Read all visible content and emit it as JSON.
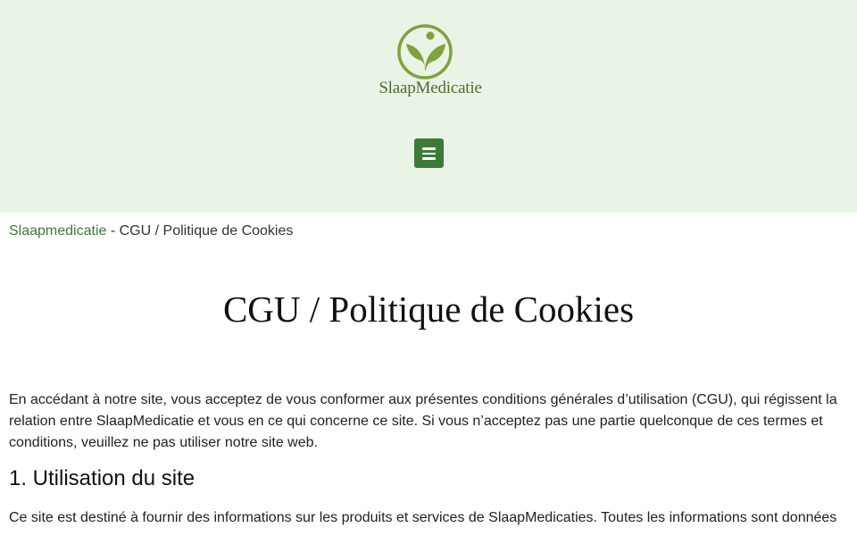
{
  "header": {
    "logo_text": "SlaapMedicatie",
    "logo_icon": "leaf-person-icon",
    "menu_icon": "hamburger-menu-icon",
    "background": "#e9f3e6",
    "accent": "#3d7a38"
  },
  "breadcrumb": {
    "home": "Slaapmedicatie",
    "separator": " - ",
    "current": "CGU / Politique de Cookies"
  },
  "page": {
    "title": "CGU / Politique de Cookies",
    "intro": "En accédant à notre site, vous acceptez de vous conformer aux présentes conditions générales d’utilisation (CGU), qui régissent la relation entre SlaapMedicatie et vous en ce qui concerne ce site. Si vous n’acceptez pas une partie quelconque de ces termes et conditions, veuillez ne pas utiliser notre site web.",
    "section1_heading": "1. Utilisation du site",
    "section1_body": "Ce site est destiné à fournir des informations sur les produits et services de SlaapMedicaties. Toutes les informations sont données"
  }
}
